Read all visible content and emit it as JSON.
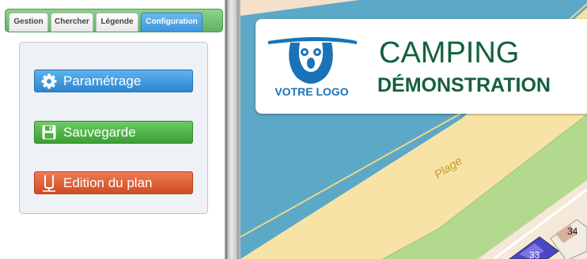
{
  "tabs": [
    {
      "label": "Gestion"
    },
    {
      "label": "Chercher"
    },
    {
      "label": "Légende"
    },
    {
      "label": "Configuration"
    }
  ],
  "config_panel": {
    "settings_label": "Paramétrage",
    "save_label": "Sauvegarde",
    "edit_plan_label": "Edition du plan"
  },
  "map": {
    "logo_text": "VOTRE LOGO",
    "title": "CAMPING",
    "subtitle": "DÉMONSTRATION",
    "beach_label": "Plage",
    "pitches": [
      "34",
      "33"
    ]
  },
  "colors": {
    "settings_button": "#3d96db",
    "save_button": "#4caf43",
    "edit_plan_button": "#e0603a",
    "active_tab": "#3d96db",
    "tab_bar": "#6bbd6b",
    "title_text": "#14603a",
    "logo_text": "#1a73b8",
    "sea": "#5ca8c7",
    "beach": "#f8e3a6",
    "grass": "#b3d98f"
  },
  "icons": [
    "gear-icon",
    "floppy-disk-icon",
    "pencil-edit-icon"
  ]
}
